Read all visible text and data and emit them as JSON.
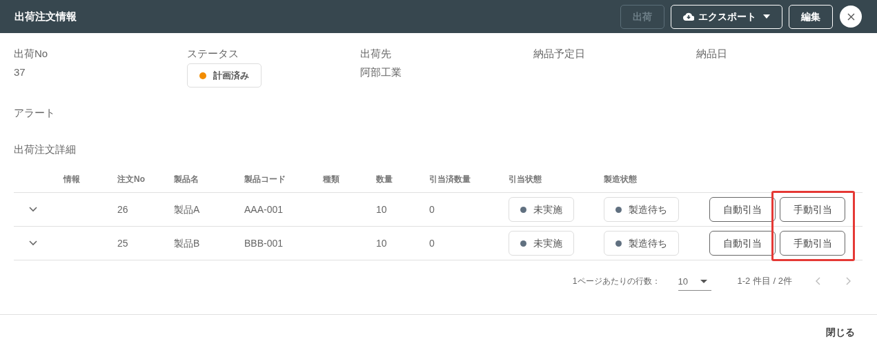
{
  "header": {
    "title": "出荷注文情報",
    "buttons": [
      {
        "kind": "ship",
        "label": "出荷",
        "disabled": true
      },
      {
        "kind": "export",
        "label": "エクスポート",
        "disabled": false
      },
      {
        "kind": "edit",
        "label": "編集",
        "disabled": false
      }
    ]
  },
  "fields": [
    {
      "label": "出荷No",
      "value": "37"
    },
    {
      "label": "ステータス",
      "status": {
        "label": "計画済み",
        "color": "#f28c00"
      }
    },
    {
      "label": "出荷先",
      "value": "阿部工業"
    },
    {
      "label": "納品予定日"
    },
    {
      "label": "納品日"
    }
  ],
  "alert_label": "アラート",
  "details_title": "出荷注文詳細",
  "table": {
    "columns": [
      "情報",
      "注文No",
      "製品名",
      "製品コード",
      "種類",
      "数量",
      "引当済数量",
      "引当状態",
      "製造状態"
    ],
    "rows": [
      {
        "order_no": "26",
        "product": "製品A",
        "code": "AAA-001",
        "quantity": "10",
        "allocated": "0",
        "allocation_status": {
          "label": "未実施",
          "color": "#607080"
        },
        "production_status": {
          "label": "製造待ち",
          "color": "#607080"
        },
        "buttons": [
          "自動引当",
          "手動引当"
        ]
      },
      {
        "order_no": "25",
        "product": "製品B",
        "code": "BBB-001",
        "quantity": "10",
        "allocated": "0",
        "allocation_status": {
          "label": "未実施",
          "color": "#607080"
        },
        "production_status": {
          "label": "製造待ち",
          "color": "#607080"
        },
        "buttons": [
          "自動引当",
          "手動引当"
        ]
      }
    ]
  },
  "highlight_manual_column": true,
  "pagination": {
    "rows_per_page_label": "1ページあたりの行数：",
    "rows_per_page": "10",
    "range": "1-2 件目 / 2件"
  },
  "footer": {
    "close_label": "閉じる"
  }
}
